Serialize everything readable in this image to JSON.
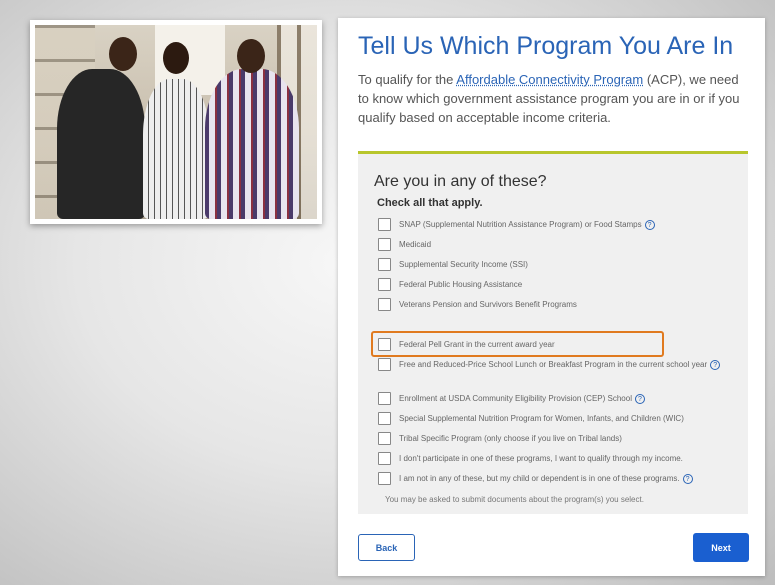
{
  "page": {
    "title": "Tell Us Which Program You Are In",
    "intro_before": "To qualify for the ",
    "intro_link": "Affordable Connectivity Program",
    "intro_after": " (ACP), we need to know which government assistance program you are in or if you qualify based on acceptable income criteria."
  },
  "question": {
    "title": "Are you in any of these?",
    "subtitle": "Check all that apply.",
    "options": [
      {
        "label": "SNAP (Supplemental Nutrition Assistance Program) or Food Stamps",
        "checked": false,
        "help": true
      },
      {
        "label": "Medicaid",
        "checked": false,
        "help": false
      },
      {
        "label": "Supplemental Security Income (SSI)",
        "checked": false,
        "help": false
      },
      {
        "label": "Federal Public Housing Assistance",
        "checked": false,
        "help": false
      },
      {
        "label": "Veterans Pension and Survivors Benefit Programs",
        "checked": false,
        "help": false
      },
      {
        "label": "Federal Pell Grant in the current award year",
        "checked": false,
        "help": false,
        "highlighted": true
      },
      {
        "label": "Free and Reduced-Price School Lunch or Breakfast Program in the current school year",
        "checked": false,
        "help": true
      },
      {
        "label": "Enrollment at USDA Community Eligibility Provision (CEP) School",
        "checked": false,
        "help": true
      },
      {
        "label": "Special Supplemental Nutrition Program for Women, Infants, and Children (WIC)",
        "checked": false,
        "help": false
      },
      {
        "label": "Tribal Specific Program (only choose if you live on Tribal lands)",
        "checked": false,
        "help": false
      },
      {
        "label": "I don't participate in one of these programs, I want to qualify through my income.",
        "checked": false,
        "help": false
      },
      {
        "label": "I am not in any of these, but my child or dependent is in one of these programs.",
        "checked": false,
        "help": true
      }
    ],
    "note": "You may be asked to submit documents about the program(s) you select."
  },
  "buttons": {
    "back": "Back",
    "next": "Next"
  },
  "icons": {
    "help_glyph": "?"
  },
  "colors": {
    "title_blue": "#2a64b6",
    "accent_line": "#b8c62c",
    "highlight_orange": "#e07a1f",
    "next_button": "#1a5fd0"
  }
}
